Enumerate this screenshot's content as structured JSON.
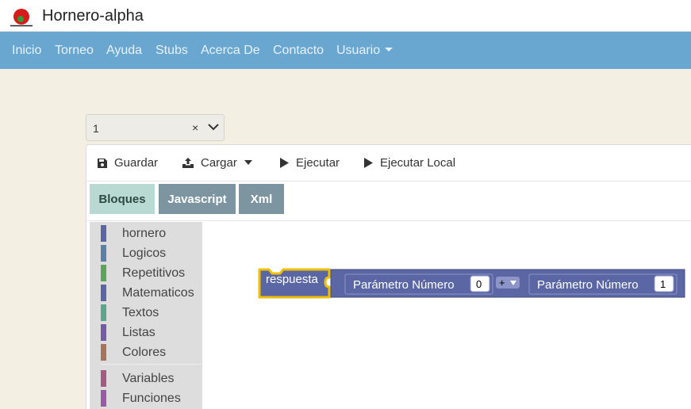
{
  "app": {
    "title": "Hornero-alpha"
  },
  "nav": {
    "items": [
      "Inicio",
      "Torneo",
      "Ayuda",
      "Stubs",
      "Acerca De",
      "Contacto"
    ],
    "user_menu": "Usuario"
  },
  "selector": {
    "value": "1",
    "clear_symbol": "×"
  },
  "toolbar": {
    "save_label": "Guardar",
    "load_label": "Cargar",
    "run_label": "Ejecutar",
    "run_local_label": "Ejecutar Local"
  },
  "tabs": [
    {
      "label": "Bloques",
      "active": true
    },
    {
      "label": "Javascript",
      "active": false
    },
    {
      "label": "Xml",
      "active": false
    }
  ],
  "toolbox": {
    "categories": [
      {
        "label": "hornero",
        "color": "#5b67a5"
      },
      {
        "label": "Logicos",
        "color": "#5b80a5"
      },
      {
        "label": "Repetitivos",
        "color": "#5ba55b"
      },
      {
        "label": "Matematicos",
        "color": "#5b67a5"
      },
      {
        "label": "Textos",
        "color": "#5ba58c"
      },
      {
        "label": "Listas",
        "color": "#745ba5"
      },
      {
        "label": "Colores",
        "color": "#a5745b"
      },
      {
        "label": "Variables",
        "color": "#a55b80"
      },
      {
        "label": "Funciones",
        "color": "#995ba5"
      }
    ]
  },
  "workspace": {
    "block": {
      "name": "respuesta",
      "param_label_1": "Parámetro Número",
      "param_value_1": "0",
      "operator": "+",
      "param_label_2": "Parámetro Número",
      "param_value_2": "1"
    }
  }
}
